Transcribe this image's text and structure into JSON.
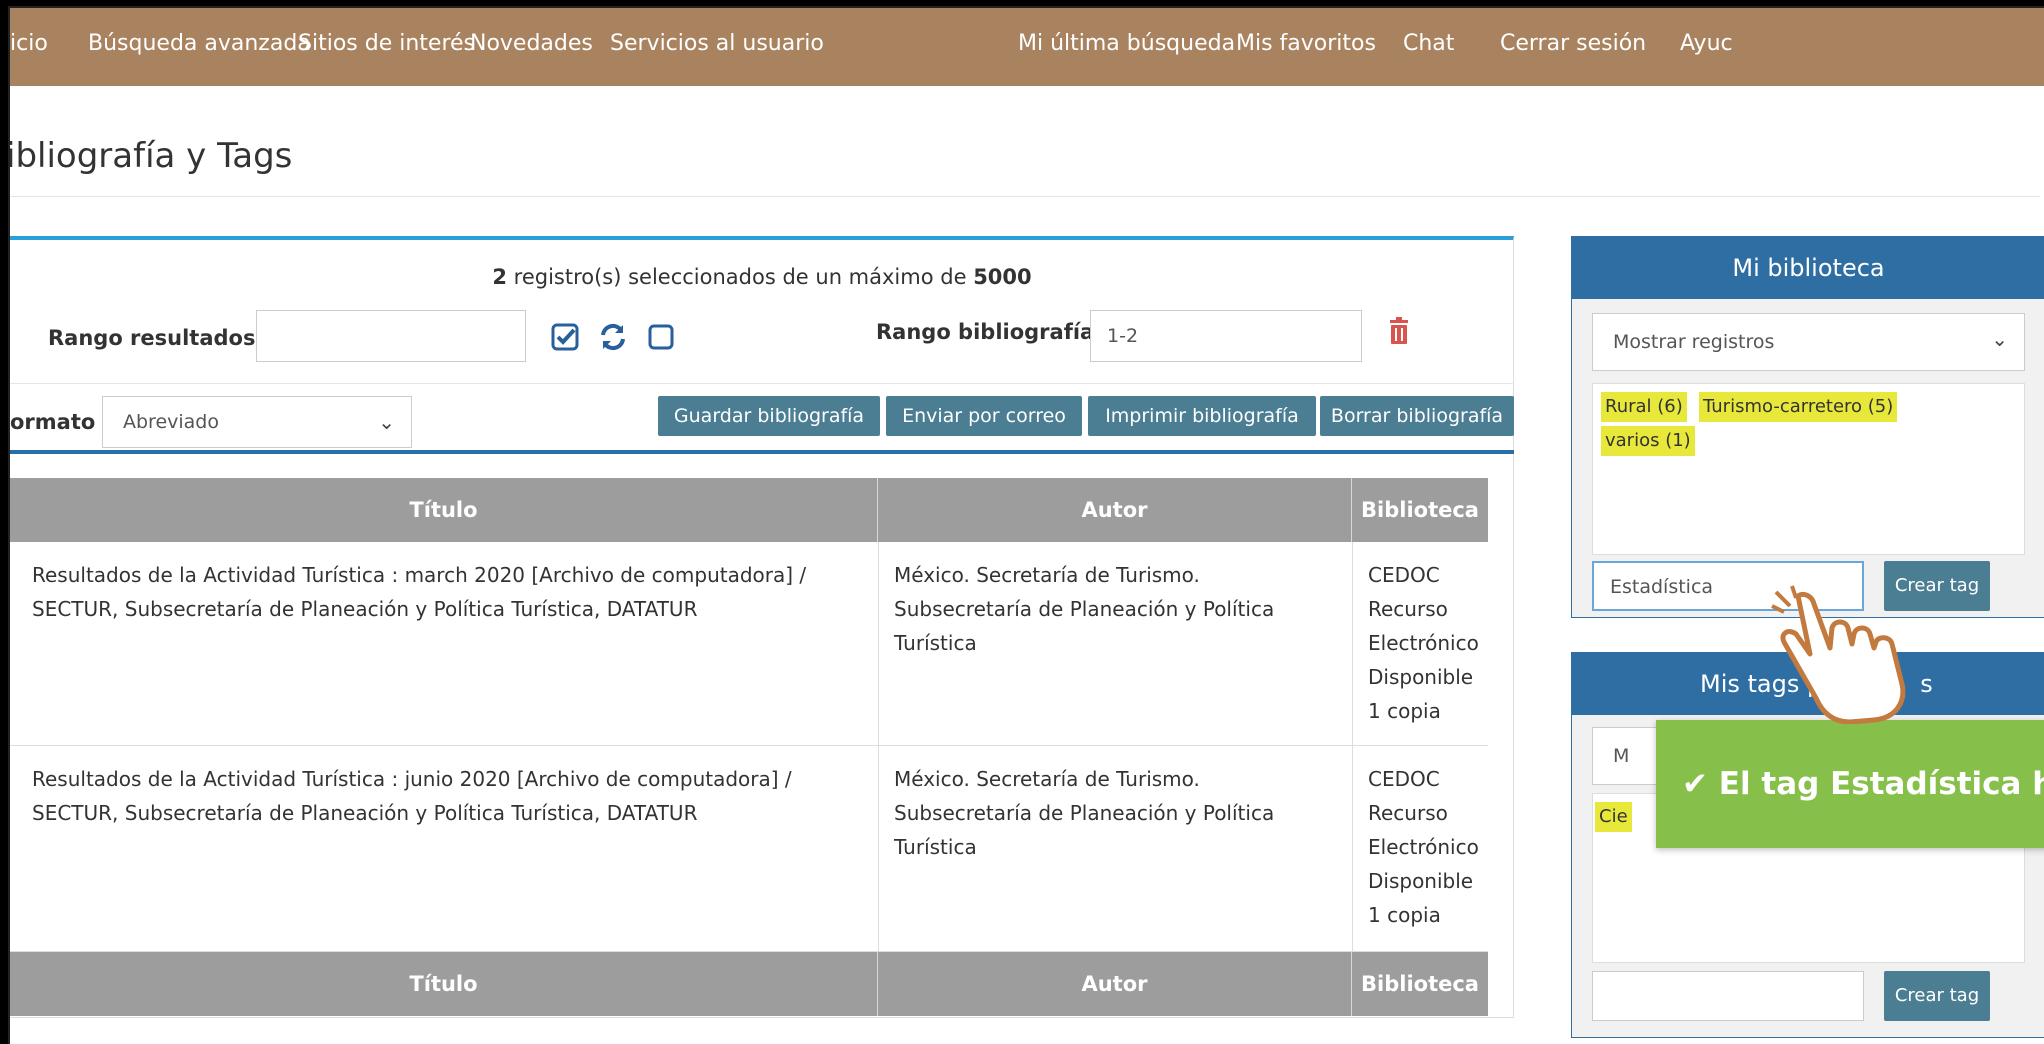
{
  "nav": {
    "left": [
      "icio",
      "Búsqueda avanzada",
      "Sitios de interés",
      "Novedades",
      "Servicios al usuario"
    ],
    "right": [
      "Mi última búsqueda",
      "Mis favoritos",
      "Chat",
      "Cerrar sesión",
      "Ayuc"
    ]
  },
  "page_title": "ibliografía y Tags",
  "selection": {
    "count": "2",
    "text_mid": " registro(s) seleccionados de un máximo de ",
    "max": "5000"
  },
  "range_results": {
    "label": "Rango resultados",
    "value": ""
  },
  "range_bibliography": {
    "label": "Rango bibliografía",
    "value": "1-2"
  },
  "format": {
    "label": "ormato",
    "selected": "Abreviado"
  },
  "buttons": {
    "save": "Guardar bibliografía",
    "email": "Enviar por correo",
    "print": "Imprimir bibliografía",
    "delete": "Borrar bibliografía"
  },
  "table": {
    "headers": [
      "Título",
      "Autor",
      "Biblioteca"
    ],
    "rows": [
      {
        "title": "Resultados de la Actividad Turística : march 2020 [Archivo de computadora] / SECTUR, Subsecretaría de Planeación y Política Turística, DATATUR",
        "author": "México. Secretaría de Turismo. Subsecretaría de Planeación y Política Turística",
        "library": [
          "CEDOC",
          "Recurso",
          "Electrónico",
          "Disponible",
          "1 copia"
        ]
      },
      {
        "title": "Resultados de la Actividad Turística : junio 2020 [Archivo de computadora] / SECTUR, Subsecretaría de Planeación y Política Turística, DATATUR",
        "author": "México. Secretaría de Turismo. Subsecretaría de Planeación y Política Turística",
        "library": [
          "CEDOC",
          "Recurso",
          "Electrónico",
          "Disponible",
          "1 copia"
        ]
      }
    ]
  },
  "my_library": {
    "title": "Mi biblioteca",
    "select": "Mostrar registros",
    "tags": [
      "Rural (6)",
      "Turismo-carretero (5)",
      "varios (1)"
    ],
    "input_value": "Estadística",
    "create_button": "Crear tag"
  },
  "public_tags": {
    "title_visible": "Mis tags p",
    "title_tail": "s",
    "select_partial": "M",
    "tag_partial": "Cie",
    "input_value": "",
    "create_button": "Crear tag"
  },
  "toast": {
    "text": "El tag Estadística ha"
  },
  "icons": {
    "check": "checkbox-checked-icon",
    "refresh": "refresh-icon",
    "empty": "checkbox-empty-icon",
    "trash": "trash-icon",
    "hand": "hand-pointer-icon"
  },
  "colors": {
    "nav": "#a9835f",
    "panel_header": "#2f6ea3",
    "button": "#4b7d93",
    "tag_highlight": "#e8e83a",
    "toast": "#86c04a",
    "table_header": "#9d9d9d",
    "accent_top": "#2d9fd8"
  }
}
